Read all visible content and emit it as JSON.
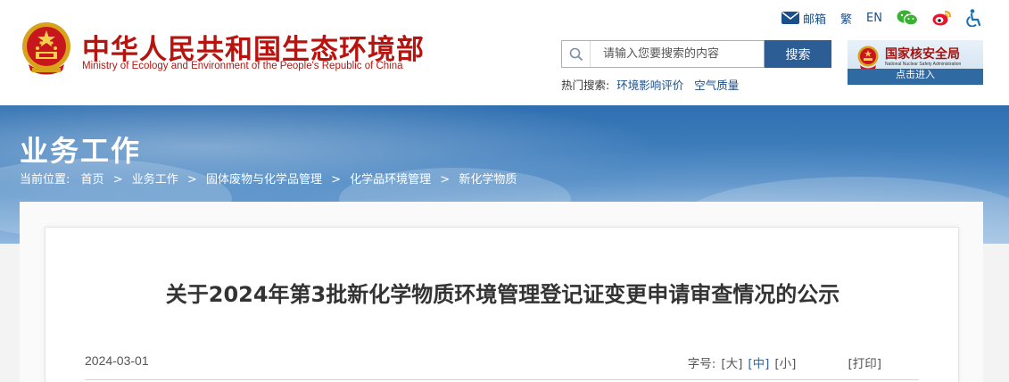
{
  "header": {
    "title_cn": "中华人民共和国生态环境部",
    "title_en": "Ministry of Ecology and Environment of the People's Republic of China",
    "toplinks": {
      "mail": "邮箱",
      "traditional": "繁",
      "english": "EN"
    },
    "search": {
      "placeholder": "请输入您要搜索的内容",
      "button": "搜索"
    },
    "hot_search": {
      "label": "热门搜索:",
      "items": [
        "环境影响评价",
        "空气质量"
      ]
    },
    "nnsa": {
      "name_cn": "国家核安全局",
      "name_en": "National Nuclear Safety Administration",
      "enter": "点击进入"
    }
  },
  "banner": {
    "title": "业务工作",
    "breadcrumb_label": "当前位置:",
    "breadcrumb": [
      "首页",
      "业务工作",
      "固体废物与化学品管理",
      "化学品环境管理",
      "新化学物质"
    ],
    "separator": ">"
  },
  "article": {
    "title": "关于2024年第3批新化学物质环境管理登记证变更申请审查情况的公示",
    "date": "2024-03-01",
    "font_size_label": "字号:",
    "font_sizes": [
      "[大]",
      "[中]",
      "[小]"
    ],
    "print": "[打印]"
  },
  "colors": {
    "brand_red": "#b7140f",
    "nav_blue": "#2c5d95",
    "link_blue": "#1b4f8a"
  },
  "icons": [
    "national-emblem-icon",
    "mail-icon",
    "wechat-icon",
    "weibo-icon",
    "accessibility-icon",
    "search-icon"
  ]
}
